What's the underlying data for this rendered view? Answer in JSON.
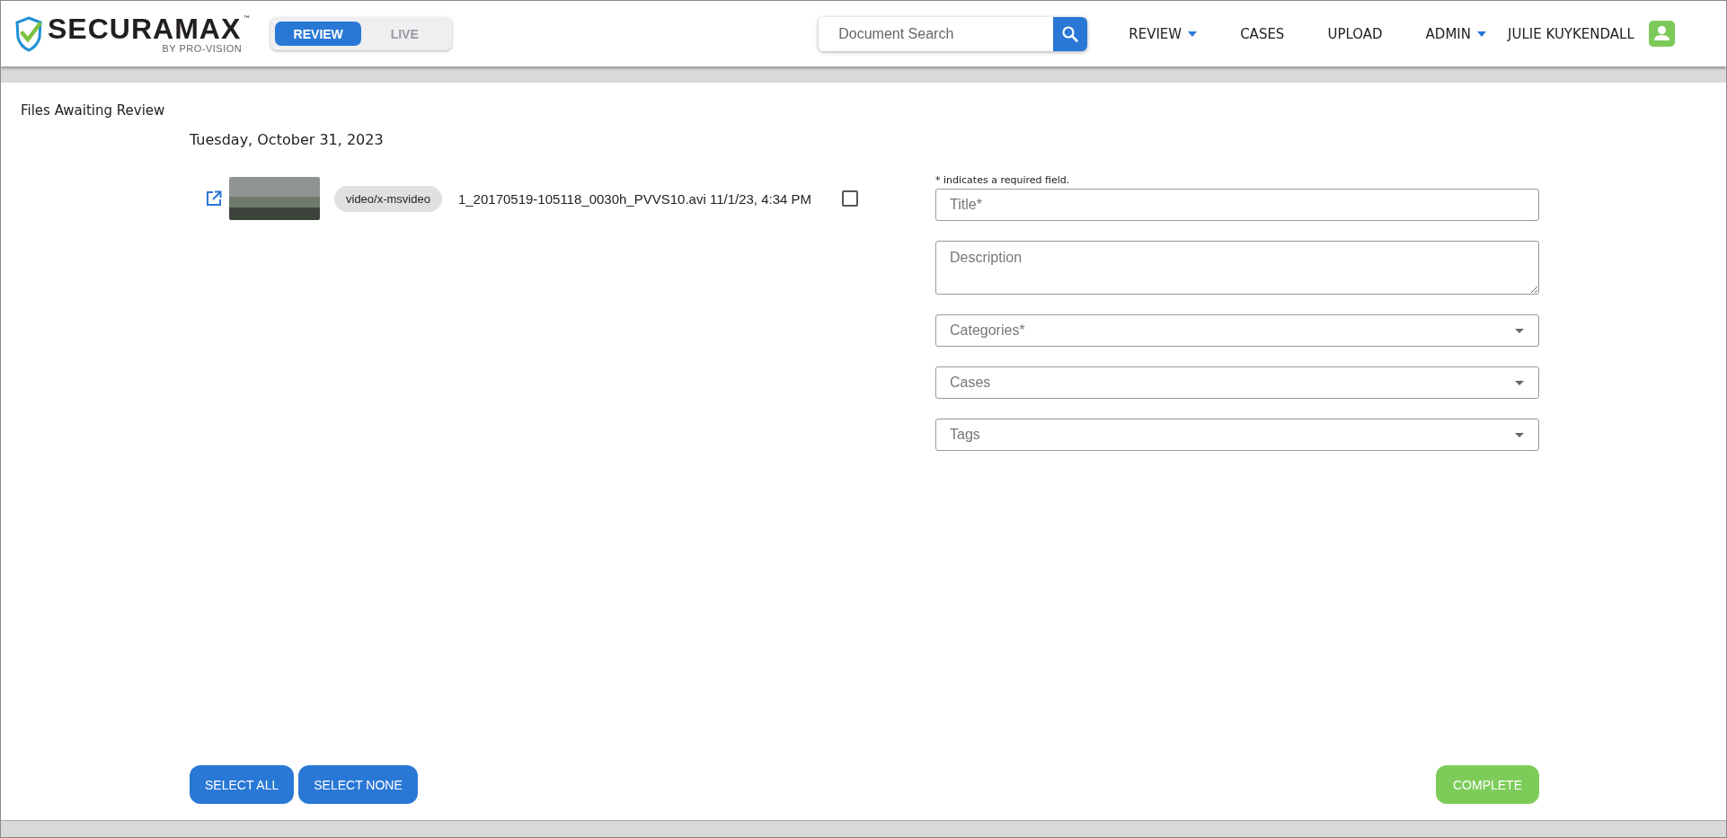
{
  "logo": {
    "name": "SECURAMAX",
    "trademark": "™",
    "tagline": "BY PRO-VISION"
  },
  "mode_toggle": [
    {
      "label": "REVIEW",
      "selected": true
    },
    {
      "label": "LIVE",
      "selected": false
    }
  ],
  "search": {
    "placeholder": "Document Search"
  },
  "nav": [
    {
      "label": "REVIEW",
      "has_menu": true
    },
    {
      "label": "CASES",
      "has_menu": false
    },
    {
      "label": "UPLOAD",
      "has_menu": false
    },
    {
      "label": "ADMIN",
      "has_menu": true
    }
  ],
  "user": {
    "name": "JULIE KUYKENDALL"
  },
  "page": {
    "title": "Files Awaiting Review"
  },
  "groups": [
    {
      "date": "Tuesday, October 31, 2023",
      "files": [
        {
          "type": "video/x-msvideo",
          "name": "1_20170519-105118_0030h_PVVS10.avi 11/1/23, 4:34 PM",
          "checked": false
        }
      ]
    }
  ],
  "form": {
    "note": "* indicates a required field.",
    "fields": [
      {
        "kind": "text",
        "placeholder": "Title*"
      },
      {
        "kind": "textarea",
        "placeholder": "Description"
      },
      {
        "kind": "select",
        "placeholder": "Categories*"
      },
      {
        "kind": "select",
        "placeholder": "Cases"
      },
      {
        "kind": "select",
        "placeholder": "Tags"
      }
    ]
  },
  "selection_buttons": [
    "SELECT ALL",
    "SELECT NONE"
  ],
  "complete_button": "COMPLETE"
}
